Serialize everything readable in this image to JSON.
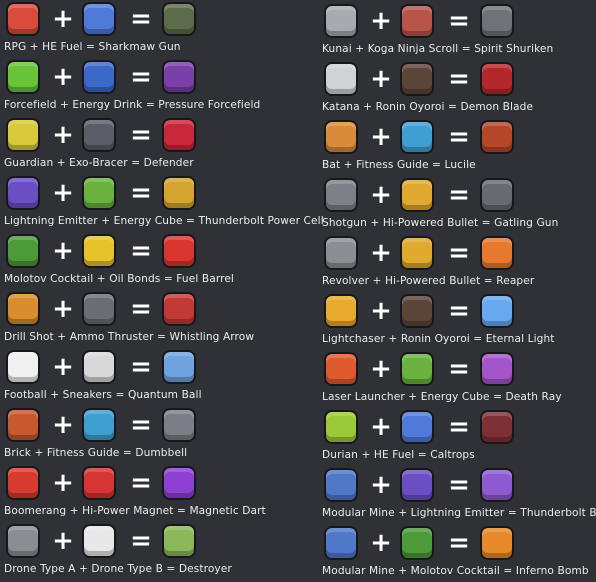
{
  "symbols": {
    "plus": "+",
    "equals": "="
  },
  "left": [
    {
      "text": "RPG + HE Fuel = Sharkmaw Gun",
      "icons": [
        "rpg-icon",
        "he-fuel-icon",
        "sharkmaw-gun-icon"
      ],
      "colors": [
        "#d94b3b",
        "#4f7ad9",
        "#5e6b4a"
      ]
    },
    {
      "text": "Forcefield + Energy Drink = Pressure Forcefield",
      "icons": [
        "forcefield-icon",
        "energy-drink-icon",
        "pressure-forcefield-icon"
      ],
      "colors": [
        "#69c43a",
        "#3b68c9",
        "#7b3fa8"
      ]
    },
    {
      "text": "Guardian + Exo-Bracer = Defender",
      "icons": [
        "guardian-icon",
        "exo-bracer-icon",
        "defender-icon"
      ],
      "colors": [
        "#d7c93a",
        "#5b5e66",
        "#c8283a"
      ]
    },
    {
      "text": "Lightning Emitter + Energy Cube = Thunderbolt Power Cell",
      "icons": [
        "lightning-emitter-icon",
        "energy-cube-icon",
        "thunderbolt-power-cell-icon"
      ],
      "colors": [
        "#6a4fc4",
        "#6ab23e",
        "#d4a431"
      ]
    },
    {
      "text": "Molotov Cocktail + Oil Bonds = Fuel Barrel",
      "icons": [
        "molotov-cocktail-icon",
        "oil-bonds-icon",
        "fuel-barrel-icon"
      ],
      "colors": [
        "#4d9a3a",
        "#e6c22b",
        "#d8362f"
      ]
    },
    {
      "text": "Drill Shot + Ammo Thruster = Whistling Arrow",
      "icons": [
        "drill-shot-icon",
        "ammo-thruster-icon",
        "whistling-arrow-icon"
      ],
      "colors": [
        "#d98d2f",
        "#6a6d74",
        "#c23a36"
      ]
    },
    {
      "text": "Football + Sneakers = Quantum Ball",
      "icons": [
        "football-icon",
        "sneakers-icon",
        "quantum-ball-icon"
      ],
      "colors": [
        "#f0f0f0",
        "#d8d8d8",
        "#6fa3e0"
      ]
    },
    {
      "text": "Brick + Fitness Guide = Dumbbell",
      "icons": [
        "brick-icon",
        "fitness-guide-icon",
        "dumbbell-icon"
      ],
      "colors": [
        "#c65a2e",
        "#3f9fd1",
        "#7b7e85"
      ]
    },
    {
      "text": "Boomerang + Hi-Power Magnet = Magnetic Dart",
      "icons": [
        "boomerang-icon",
        "hi-power-magnet-icon",
        "magnetic-dart-icon"
      ],
      "colors": [
        "#d93a2f",
        "#d73434",
        "#8f3fd1"
      ]
    },
    {
      "text": "Drone Type A + Drone Type B = Destroyer",
      "icons": [
        "drone-type-a-icon",
        "drone-type-b-icon",
        "destroyer-icon"
      ],
      "colors": [
        "#8a8d94",
        "#e8e8e8",
        "#8bb85a"
      ]
    }
  ],
  "right": [
    {
      "text": "Kunai + Koga Ninja Scroll = Spirit Shuriken",
      "icons": [
        "kunai-icon",
        "koga-ninja-scroll-icon",
        "spirit-shuriken-icon"
      ],
      "colors": [
        "#a7aab0",
        "#b8554a",
        "#6f7279"
      ]
    },
    {
      "text": "Katana + Ronin Oyoroi = Demon Blade",
      "icons": [
        "katana-icon",
        "ronin-oyoroi-icon",
        "demon-blade-icon"
      ],
      "colors": [
        "#cfd2d6",
        "#5b4438",
        "#b3282d"
      ]
    },
    {
      "text": "Bat + Fitness Guide = Lucile",
      "icons": [
        "bat-icon",
        "fitness-guide-icon",
        "lucile-icon"
      ],
      "colors": [
        "#d98b3b",
        "#3f9fd1",
        "#b5462a"
      ]
    },
    {
      "text": "Shotgun + Hi-Powered Bullet = Gatling Gun",
      "icons": [
        "shotgun-icon",
        "hi-powered-bullet-icon",
        "gatling-gun-icon"
      ],
      "colors": [
        "#7d8087",
        "#e0a92f",
        "#666a71"
      ]
    },
    {
      "text": "Revolver + Hi-Powered Bullet = Reaper",
      "icons": [
        "revolver-icon",
        "hi-powered-bullet-icon",
        "reaper-icon"
      ],
      "colors": [
        "#8b8e94",
        "#e0a92f",
        "#e7782f"
      ]
    },
    {
      "text": "Lightchaser + Ronin Oyoroi = Eternal Light",
      "icons": [
        "lightchaser-icon",
        "ronin-oyoroi-icon",
        "eternal-light-icon"
      ],
      "colors": [
        "#e6aa2f",
        "#5b4438",
        "#6aa8f0"
      ]
    },
    {
      "text": "Laser Launcher + Energy Cube = Death Ray",
      "icons": [
        "laser-launcher-icon",
        "energy-cube-icon",
        "death-ray-icon"
      ],
      "colors": [
        "#e05a30",
        "#6ab23e",
        "#a455c9"
      ]
    },
    {
      "text": "Durian + HE Fuel = Caltrops",
      "icons": [
        "durian-icon",
        "he-fuel-icon",
        "caltrops-icon"
      ],
      "colors": [
        "#9bc93a",
        "#4f7ad9",
        "#7f3036"
      ]
    },
    {
      "text": "Modular Mine + Lightning Emitter = Thunderbolt Bomb",
      "icons": [
        "modular-mine-icon",
        "lightning-emitter-icon",
        "thunderbolt-bomb-icon"
      ],
      "colors": [
        "#4f78c8",
        "#6a4fc4",
        "#8f5ad1"
      ]
    },
    {
      "text": "Modular Mine + Molotov Cocktail = Inferno Bomb",
      "icons": [
        "modular-mine-icon",
        "molotov-cocktail-icon",
        "inferno-bomb-icon"
      ],
      "colors": [
        "#4f78c8",
        "#4d9a3a",
        "#e88a2b"
      ]
    }
  ]
}
